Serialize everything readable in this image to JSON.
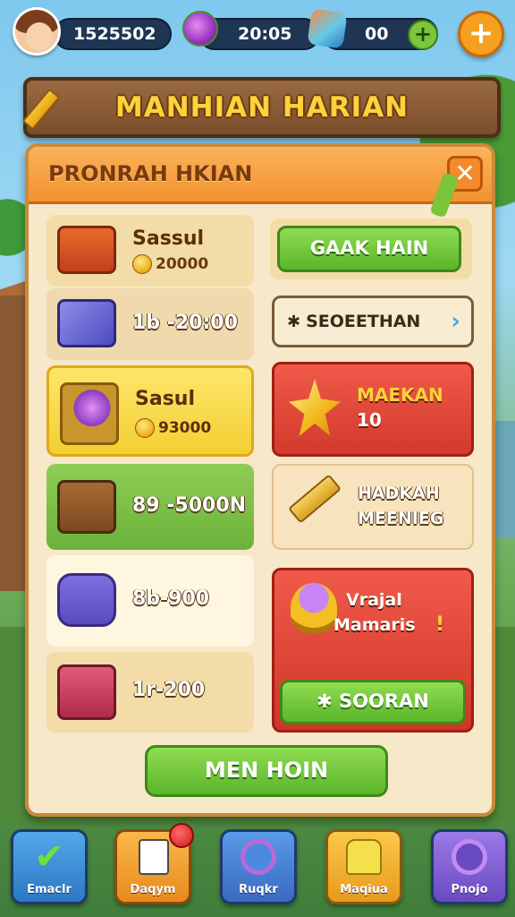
{
  "topbar": {
    "coins": "1525502",
    "time": "20:05",
    "gems": "00",
    "plus_small": "+",
    "plus_big": "+"
  },
  "title": "MANHIAN HARIAN",
  "panel": {
    "title": "PRONRAH HKIAN",
    "close": "✕"
  },
  "rewards": [
    {
      "label": "Sassul",
      "amount": "20000"
    },
    {
      "label": "1b -20:00"
    },
    {
      "label": "Sasul",
      "amount": "93000"
    },
    {
      "label": "89 -5000N"
    },
    {
      "label": "8b-900"
    },
    {
      "label": "1r-200"
    }
  ],
  "right": {
    "claim_button": "GAAK HAIN",
    "select_button": "SEOEETHAN",
    "select_star": "✱",
    "select_chevron": "›",
    "red_card": {
      "line1": "MAEKAN",
      "line2": "10"
    },
    "cream_card": {
      "line1": "HADKAH",
      "line2": "MEENIEG"
    },
    "big_card": {
      "line1": "Vrajal",
      "line2": "Mamaris",
      "excl": "!",
      "button": "✱ SOORAN"
    }
  },
  "main_button": "MEN HOIN",
  "nav": [
    {
      "label": "Emaclr"
    },
    {
      "label": "Daqym"
    },
    {
      "label": "Ruqkr"
    },
    {
      "label": "Maqiua"
    },
    {
      "label": "Pnojo"
    }
  ]
}
